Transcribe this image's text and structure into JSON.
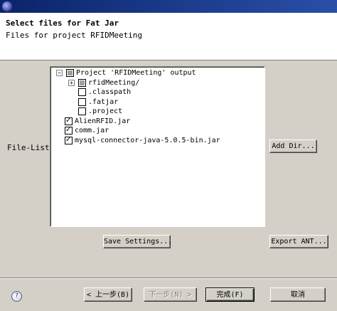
{
  "header": {
    "title": "Select files for Fat Jar",
    "subtitle": "Files for project RFIDMeeting"
  },
  "file_list": {
    "label": "File-List:",
    "tree": [
      {
        "label": "Project 'RFIDMeeting' output",
        "state": "partial",
        "expander": "−"
      },
      {
        "label": "rfidMeeting/",
        "state": "partial",
        "expander": "+"
      },
      {
        "label": ".classpath",
        "state": "unchecked"
      },
      {
        "label": ".fatjar",
        "state": "unchecked"
      },
      {
        "label": ".project",
        "state": "unchecked"
      },
      {
        "label": "AlienRFID.jar",
        "state": "checked"
      },
      {
        "label": "comm.jar",
        "state": "checked"
      },
      {
        "label": "mysql-connector-java-5.0.5-bin.jar",
        "state": "checked"
      }
    ]
  },
  "buttons": {
    "add_dir": "Add Dir...",
    "save_settings": "Save Settings...",
    "export_ant": "Export ANT...",
    "back": "< 上一步(B)",
    "next": "下一步(N) >",
    "finish": "完成(F)",
    "cancel": "取消"
  },
  "icons": {
    "app": "eclipse-icon",
    "help": "?"
  }
}
